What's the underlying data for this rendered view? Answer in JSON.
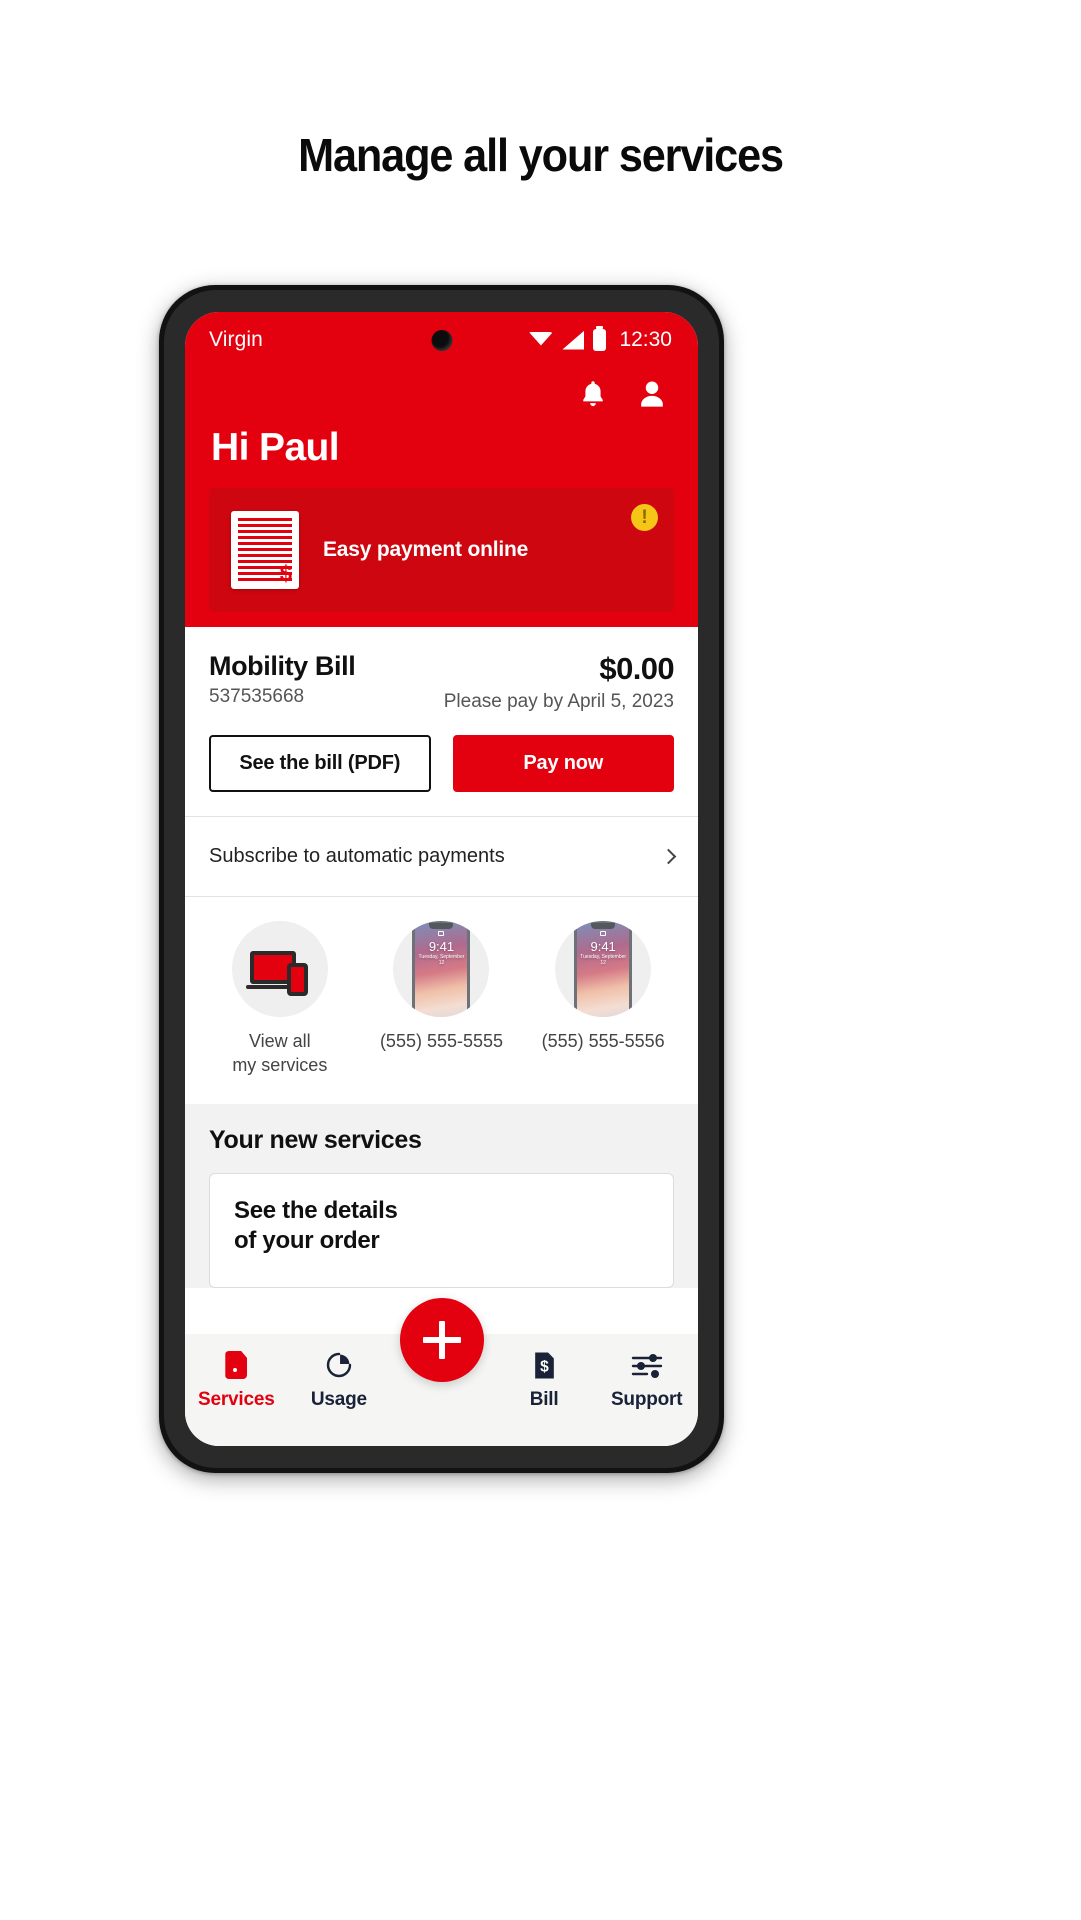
{
  "page": {
    "heading": "Manage all your services"
  },
  "phone": {
    "status_bar": {
      "carrier": "Virgin",
      "time": "12:30",
      "wifi_icon": "wifi-icon",
      "signal_icon": "signal-icon",
      "battery_icon": "battery-icon"
    },
    "header": {
      "notification_icon": "bell-icon",
      "profile_icon": "person-icon",
      "greeting": "Hi Paul",
      "promo": {
        "title": "Easy payment online",
        "doc_icon": "invoice-icon",
        "badge": "!",
        "badge_color": "#F5C518",
        "card_color": "#CE0610"
      },
      "background_color": "#E3000F"
    },
    "bill": {
      "title": "Mobility Bill",
      "account_number": "537535668",
      "amount": "$0.00",
      "due_text": "Please pay by April 5, 2023",
      "see_bill_button": "See the bill (PDF)",
      "pay_now_button": "Pay now"
    },
    "subscribe": {
      "label": "Subscribe to automatic payments",
      "chevron_icon": "chevron-right-icon"
    },
    "services": [
      {
        "label_line1": "View all",
        "label_line2": "my services",
        "icon": "devices-icon"
      },
      {
        "label_line1": "(555) 555-5555",
        "label_line2": "",
        "icon": "iphone-photo",
        "screen_time": "9:41",
        "screen_date": "Tuesday, September 12"
      },
      {
        "label_line1": "(555) 555-5556",
        "label_line2": "",
        "icon": "iphone-photo",
        "screen_time": "9:41",
        "screen_date": "Tuesday, September 12"
      }
    ],
    "new_services": {
      "title": "Your new services",
      "card_title_line1": "See the details",
      "card_title_line2": "of your order"
    },
    "tabbar": {
      "fab_icon": "plus-icon",
      "items": [
        {
          "label": "Services",
          "icon": "sim-card-icon",
          "active": true
        },
        {
          "label": "Usage",
          "icon": "pie-chart-icon",
          "active": false
        },
        {
          "label": "Bill",
          "icon": "bill-document-icon",
          "active": false
        },
        {
          "label": "Support",
          "icon": "settings-sliders-icon",
          "active": false
        }
      ],
      "active_color": "#E3000F",
      "inactive_color": "#1A2238"
    }
  }
}
